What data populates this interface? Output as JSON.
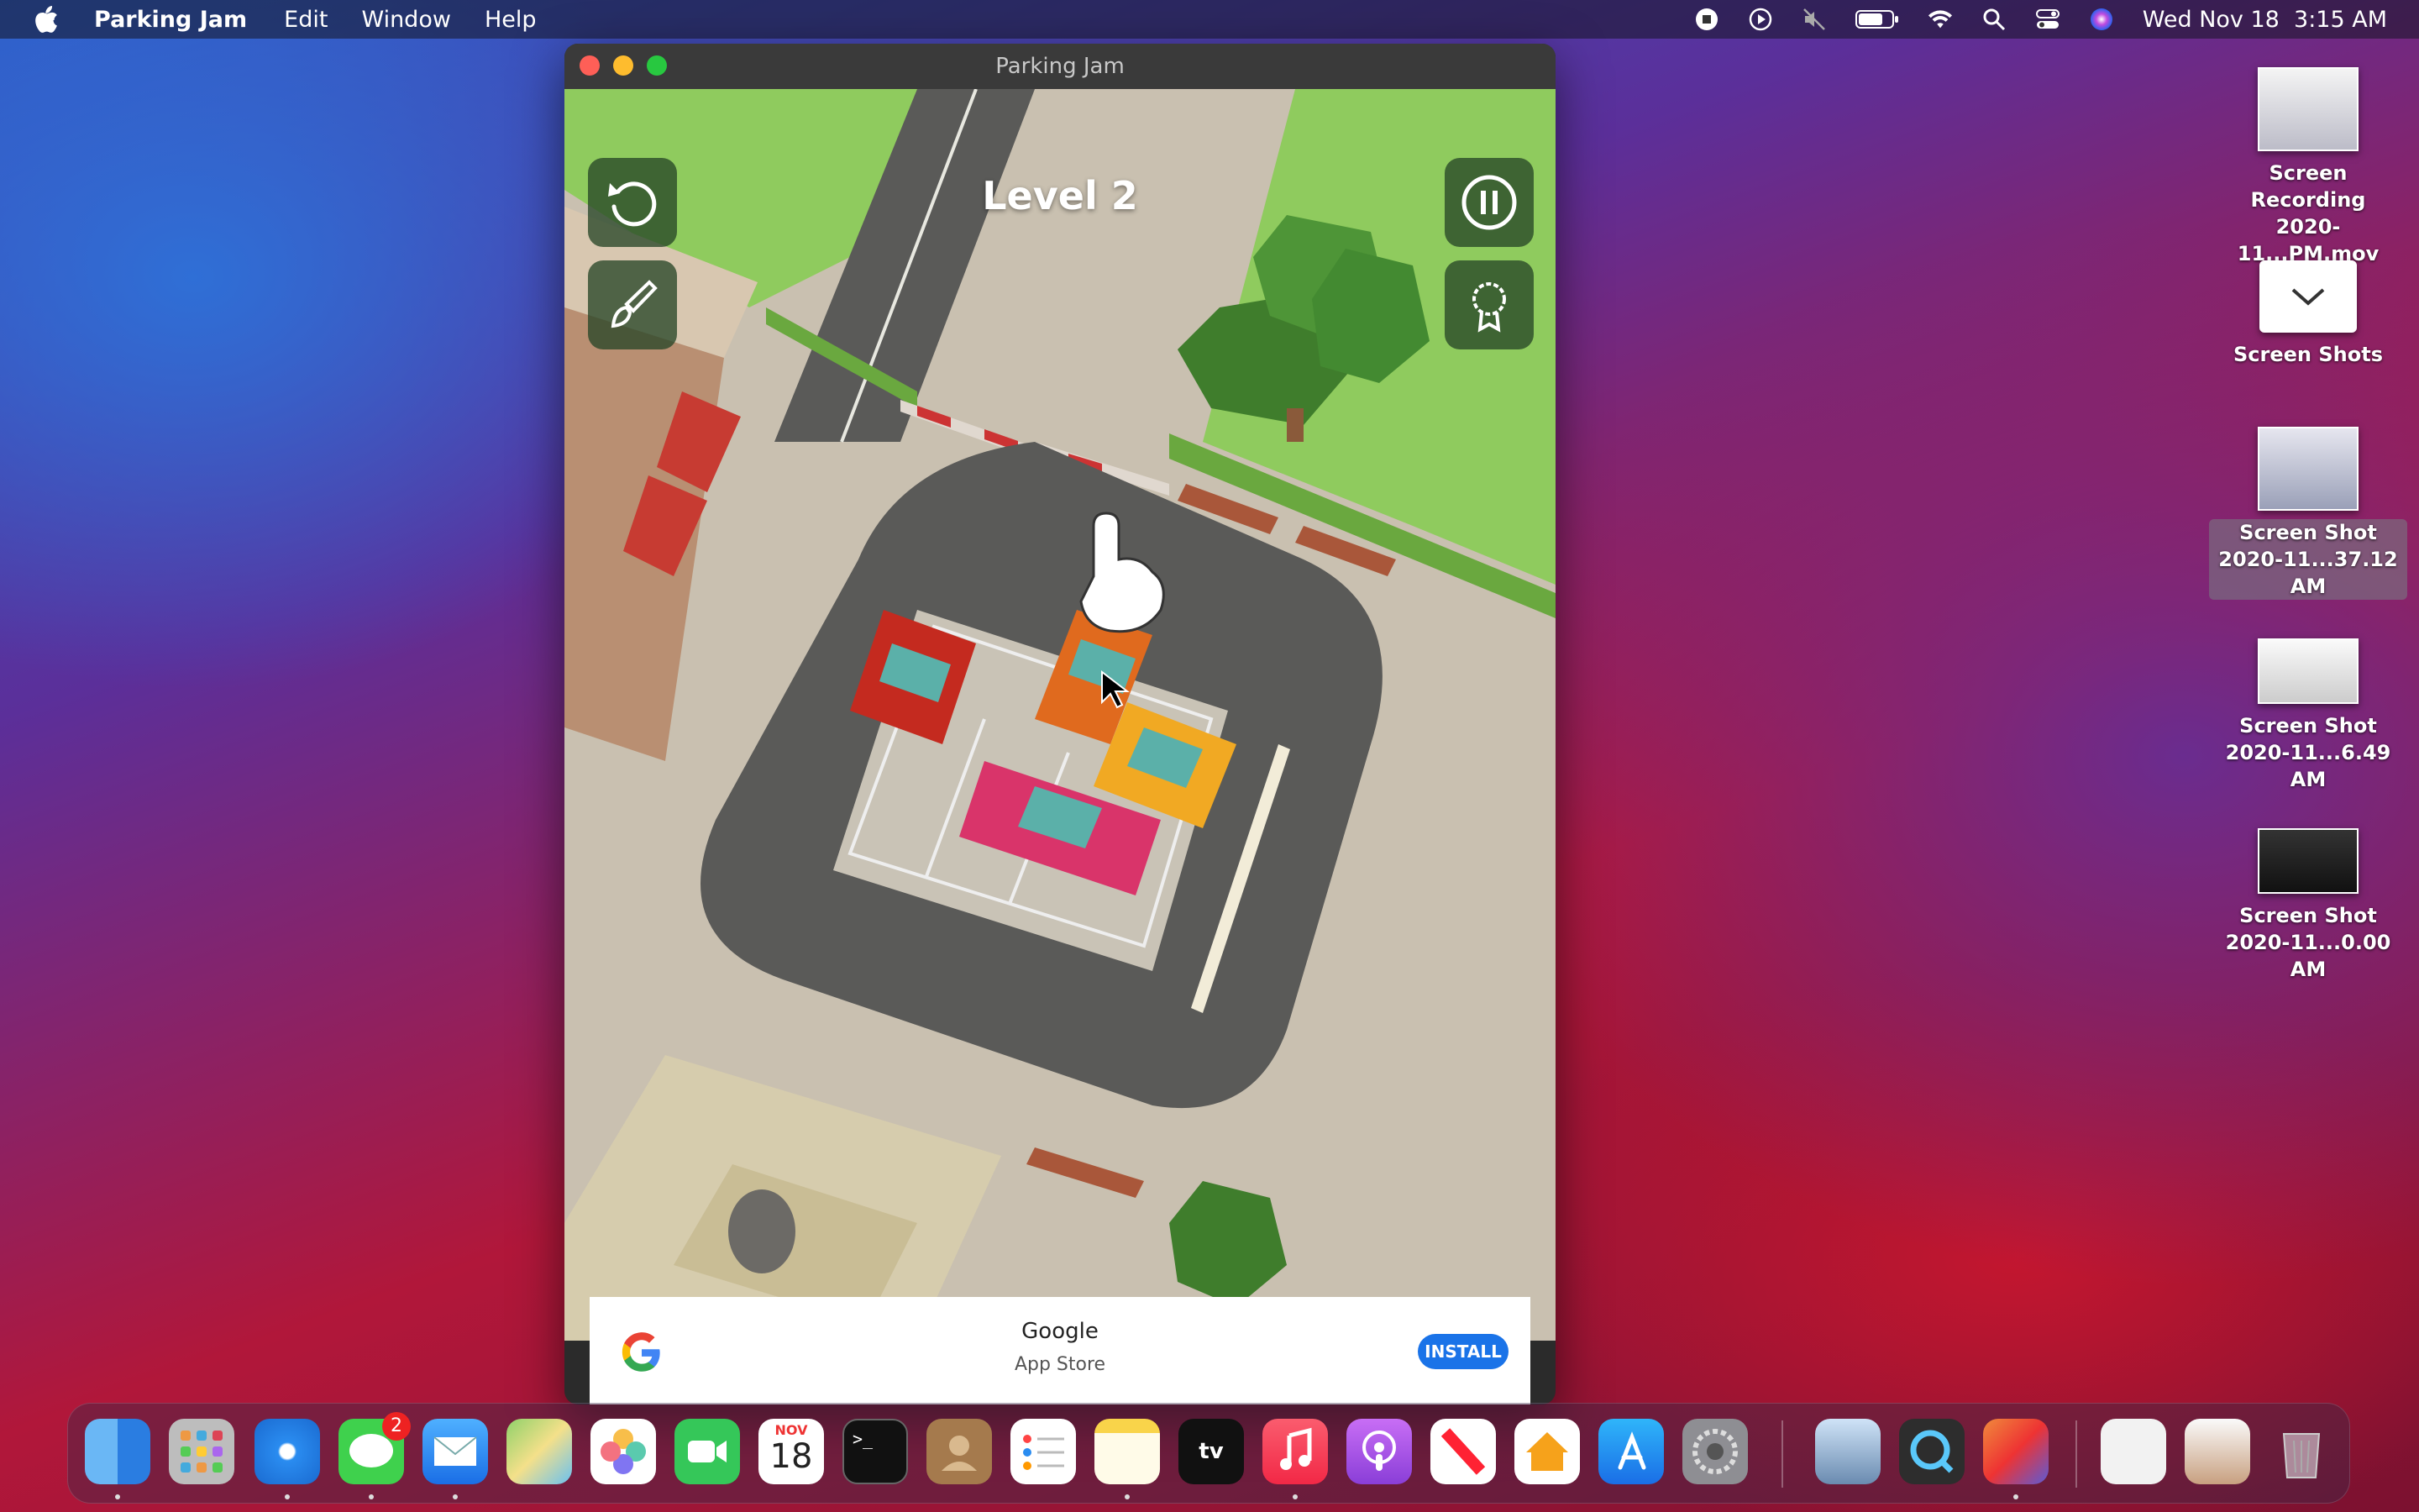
{
  "menubar": {
    "app_name": "Parking Jam",
    "menus": [
      "Edit",
      "Window",
      "Help"
    ],
    "clock": "Wed Nov 18  3:15 AM",
    "status_icons": [
      "screen-record-stop-icon",
      "play-icon",
      "mute-icon",
      "battery-icon",
      "wifi-icon",
      "search-icon",
      "control-center-icon",
      "siri-icon"
    ]
  },
  "window": {
    "title": "Parking Jam"
  },
  "game": {
    "level_label": "Level 2",
    "buttons": [
      "restart-icon",
      "paint-brush-icon",
      "pause-icon",
      "badge-icon"
    ]
  },
  "ad": {
    "title": "Google",
    "subtitle": "App Store",
    "install_label": "INSTALL"
  },
  "desktop_icons": [
    {
      "line1": "Screen Recording",
      "line2": "2020-11...PM.mov"
    },
    {
      "line1": "Screen Shots",
      "line2": ""
    },
    {
      "line1": "Screen Shot",
      "line2": "2020-11...37.12 AM"
    },
    {
      "line1": "Screen Shot",
      "line2": "2020-11...6.49 AM"
    },
    {
      "line1": "Screen Shot",
      "line2": "2020-11...0.00 AM"
    }
  ],
  "dock": {
    "messages_badge": "2",
    "calendar_month": "NOV",
    "calendar_day": "18",
    "tv_label": "tv"
  },
  "colors": {
    "accent_install": "#1a73e8",
    "grass": "#8fcb5e",
    "asphalt": "#5a5a58"
  }
}
